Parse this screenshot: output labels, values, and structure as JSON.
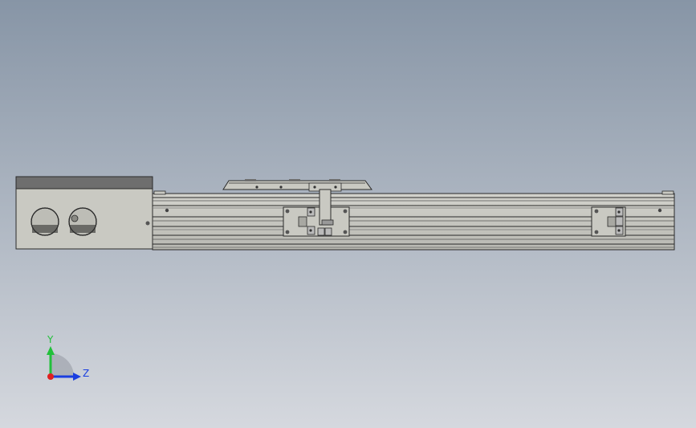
{
  "viewport": {
    "background_top": "#8795a6",
    "background_bottom": "#d5d8de"
  },
  "model": {
    "view": "front",
    "body_color": "#c8c8c2",
    "dark_cap_color": "#6e6e6e",
    "line_color": "#2a2a2a"
  },
  "triad": {
    "y_label": "Y",
    "z_label": "Z",
    "y_color": "#22c03a",
    "z_color": "#1a3ee0",
    "x_color": "#e02020"
  }
}
